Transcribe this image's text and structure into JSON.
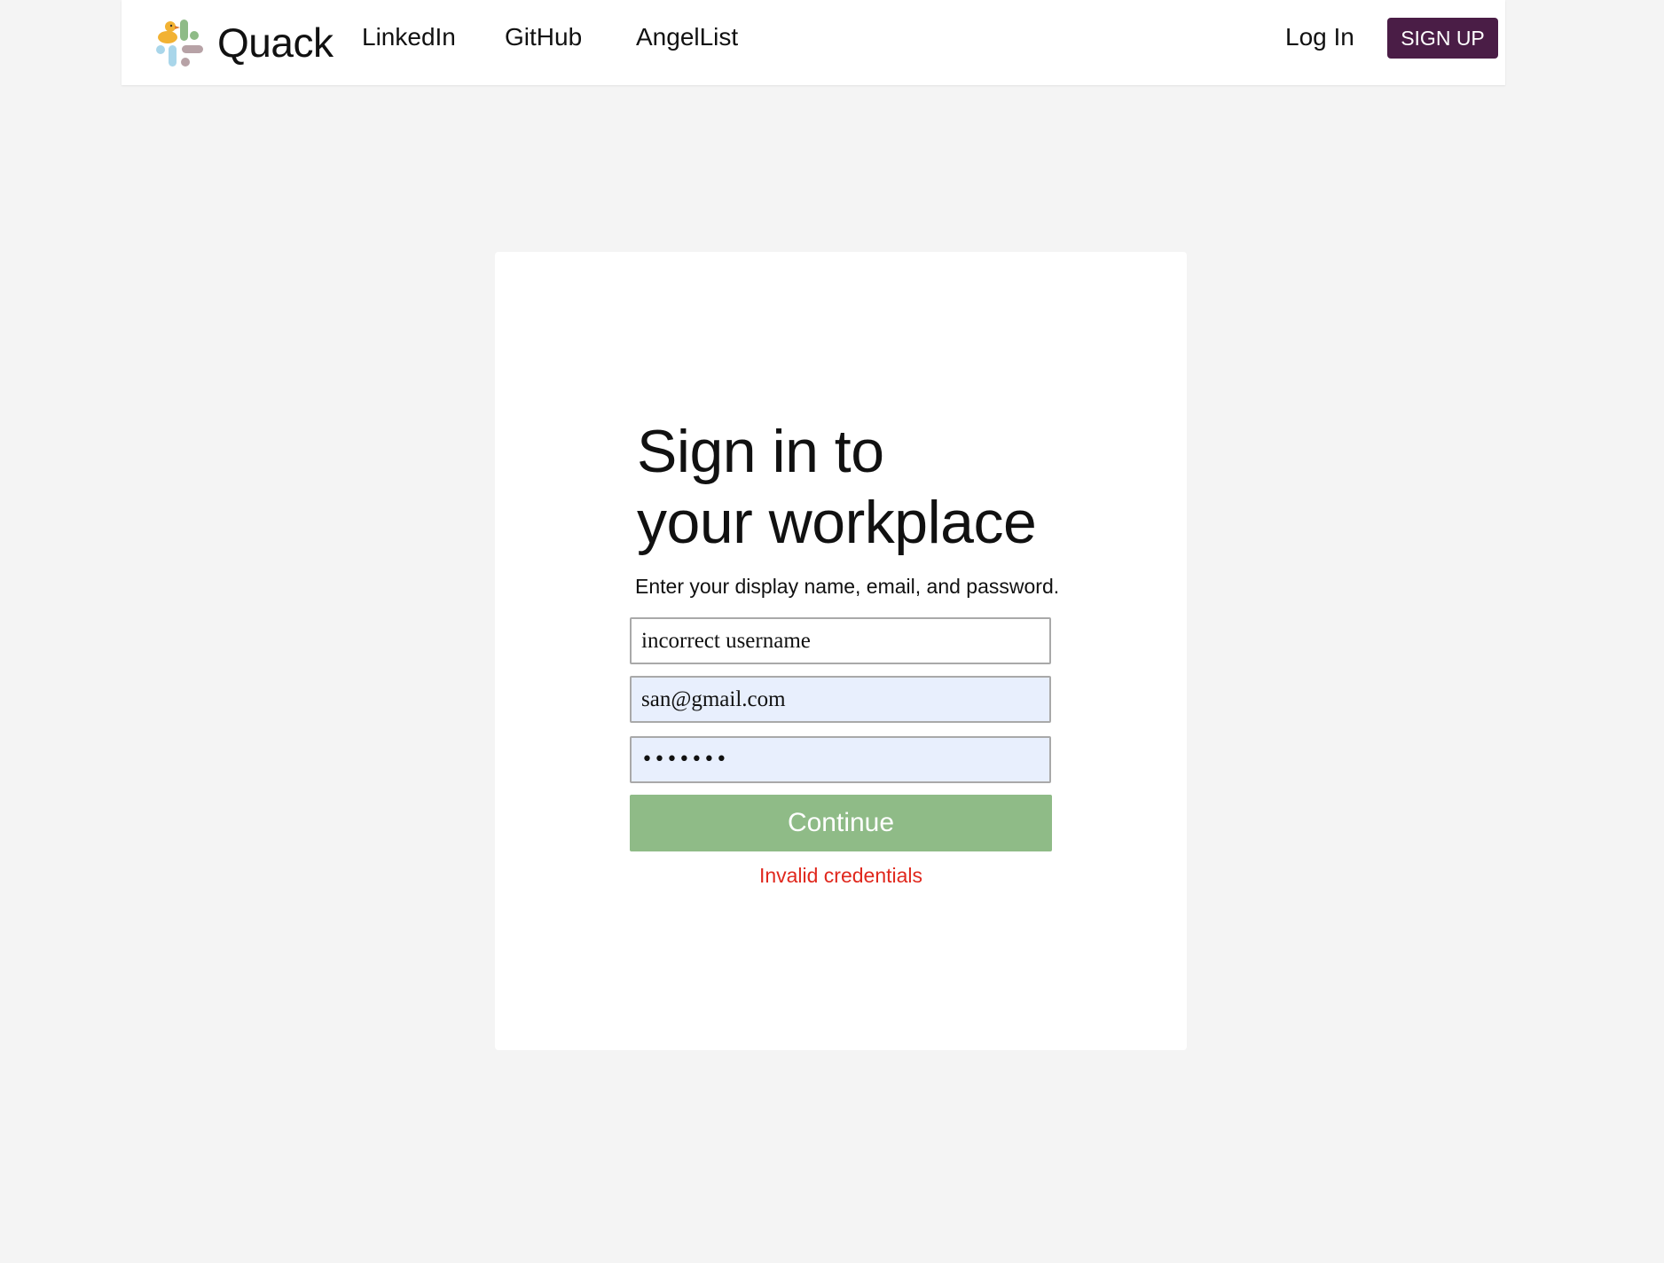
{
  "header": {
    "brand_name": "Quack",
    "nav": [
      {
        "label": "LinkedIn"
      },
      {
        "label": "GitHub"
      },
      {
        "label": "AngelList"
      }
    ],
    "login_label": "Log In",
    "signup_label": "SIGN UP"
  },
  "signin": {
    "heading_line1": "Sign in to",
    "heading_line2": "your workplace",
    "subtitle": "Enter your display name, email, and password.",
    "username_value": "incorrect username",
    "email_value": "san@gmail.com",
    "password_value": "1234567",
    "continue_label": "Continue",
    "error_message": "Invalid credentials"
  },
  "colors": {
    "signup_bg": "#4a1d46",
    "continue_bg": "#8fbb87",
    "error_text": "#e0281d",
    "autofill_bg": "#e8effd",
    "page_bg": "#f4f4f4"
  },
  "icons": {
    "logo": "quack-duck-logo-icon"
  }
}
